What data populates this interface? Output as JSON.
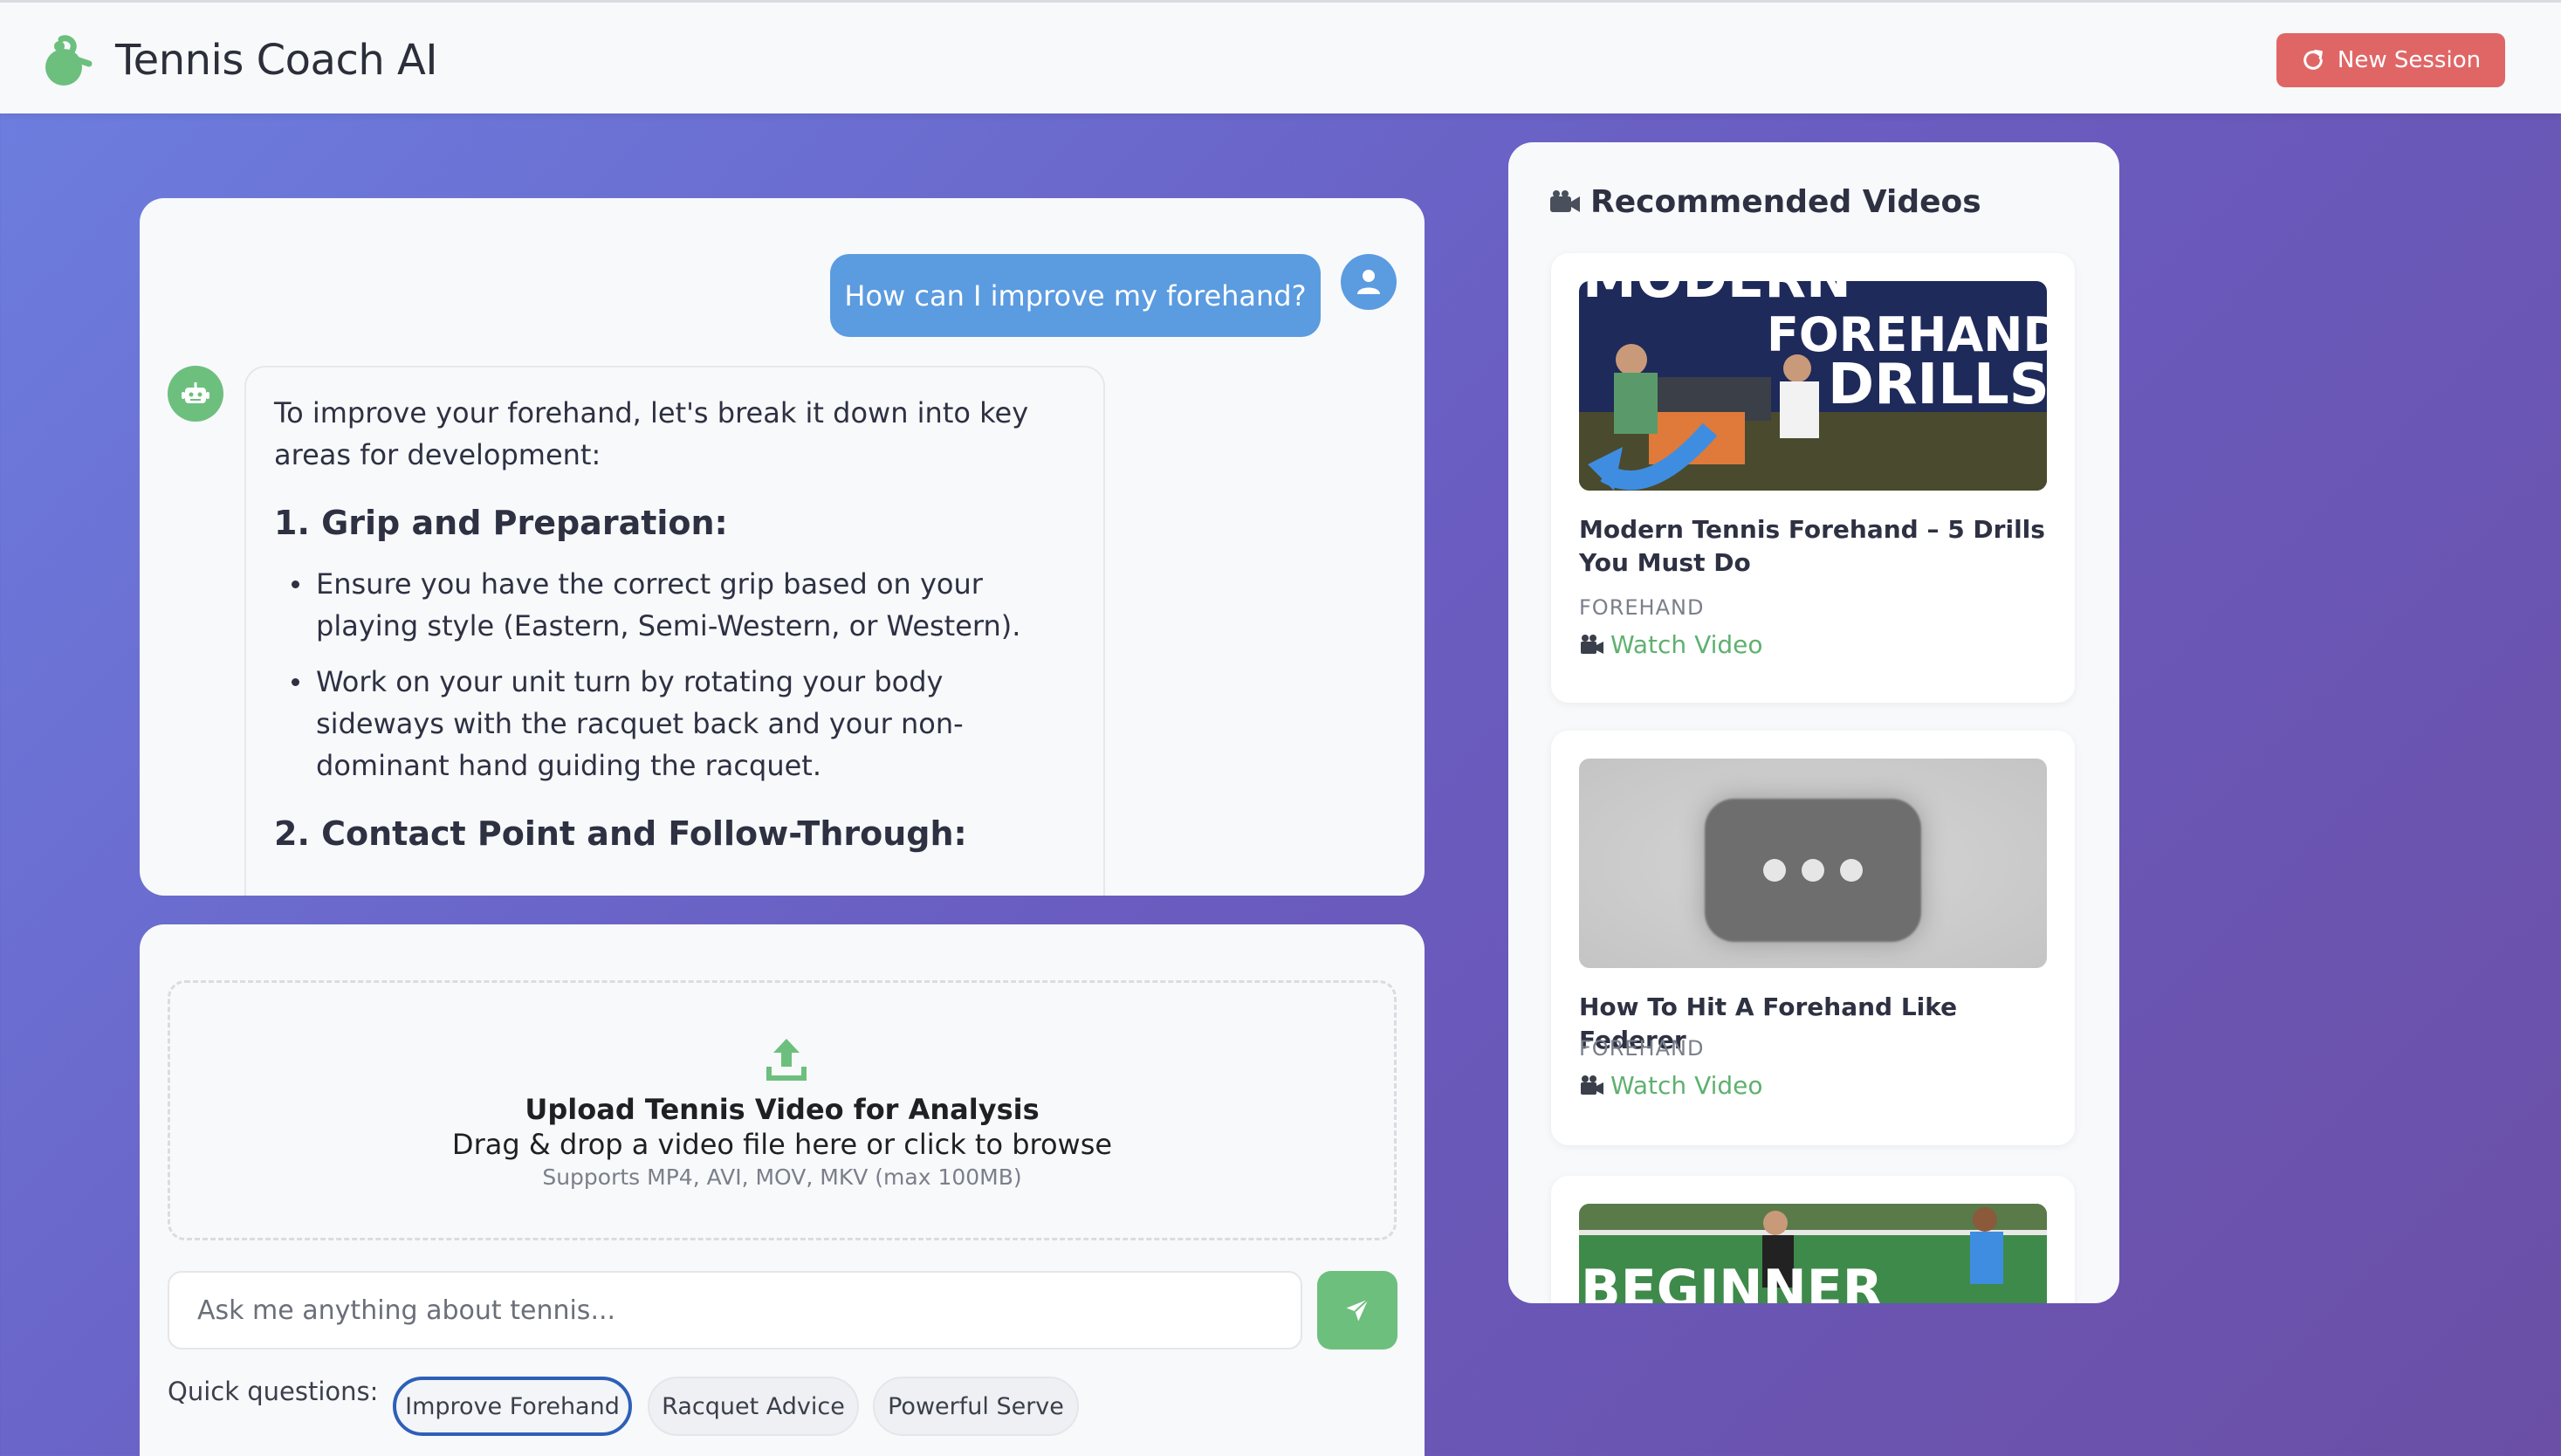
{
  "header": {
    "title": "Tennis Coach AI",
    "new_session_label": "New Session"
  },
  "chat": {
    "user_message": "How can I improve my forehand?",
    "bot_message": {
      "intro": "To improve your forehand, let's break it down into key areas for development:",
      "sections": [
        {
          "heading": "1. Grip and Preparation:",
          "bullets": [
            "Ensure you have the correct grip based on your playing style (Eastern, Semi-Western, or Western).",
            "Work on your unit turn by rotating your body sideways with the racquet back and your non-dominant hand guiding the racquet."
          ]
        },
        {
          "heading": "2. Contact Point and Follow-Through:"
        }
      ]
    }
  },
  "upload": {
    "title": "Upload Tennis Video for Analysis",
    "subtitle": "Drag & drop a video file here or click to browse",
    "note": "Supports MP4, AVI, MOV, MKV (max 100MB)"
  },
  "input": {
    "placeholder": "Ask me anything about tennis..."
  },
  "quick": {
    "label": "Quick questions:",
    "chips": [
      "Improve Forehand",
      "Racquet Advice",
      "Powerful Serve"
    ]
  },
  "videos": {
    "title": "Recommended Videos",
    "items": [
      {
        "title": "Modern Tennis Forehand – 5 Drills You Must Do",
        "category": "FOREHAND",
        "watch_label": "Watch Video",
        "thumb_text_1": "MODERN",
        "thumb_text_2": "FOREHAND",
        "thumb_text_3": "DRILLS"
      },
      {
        "title": "How To Hit A Forehand Like Federer",
        "category": "FOREHAND",
        "watch_label": "Watch Video"
      },
      {
        "thumb_text": "BEGINNER"
      }
    ]
  },
  "colors": {
    "accent_green": "#6dbf7d",
    "user_blue": "#5b9be0",
    "new_session_red": "#e06666",
    "active_chip_border": "#2e5fb8"
  }
}
